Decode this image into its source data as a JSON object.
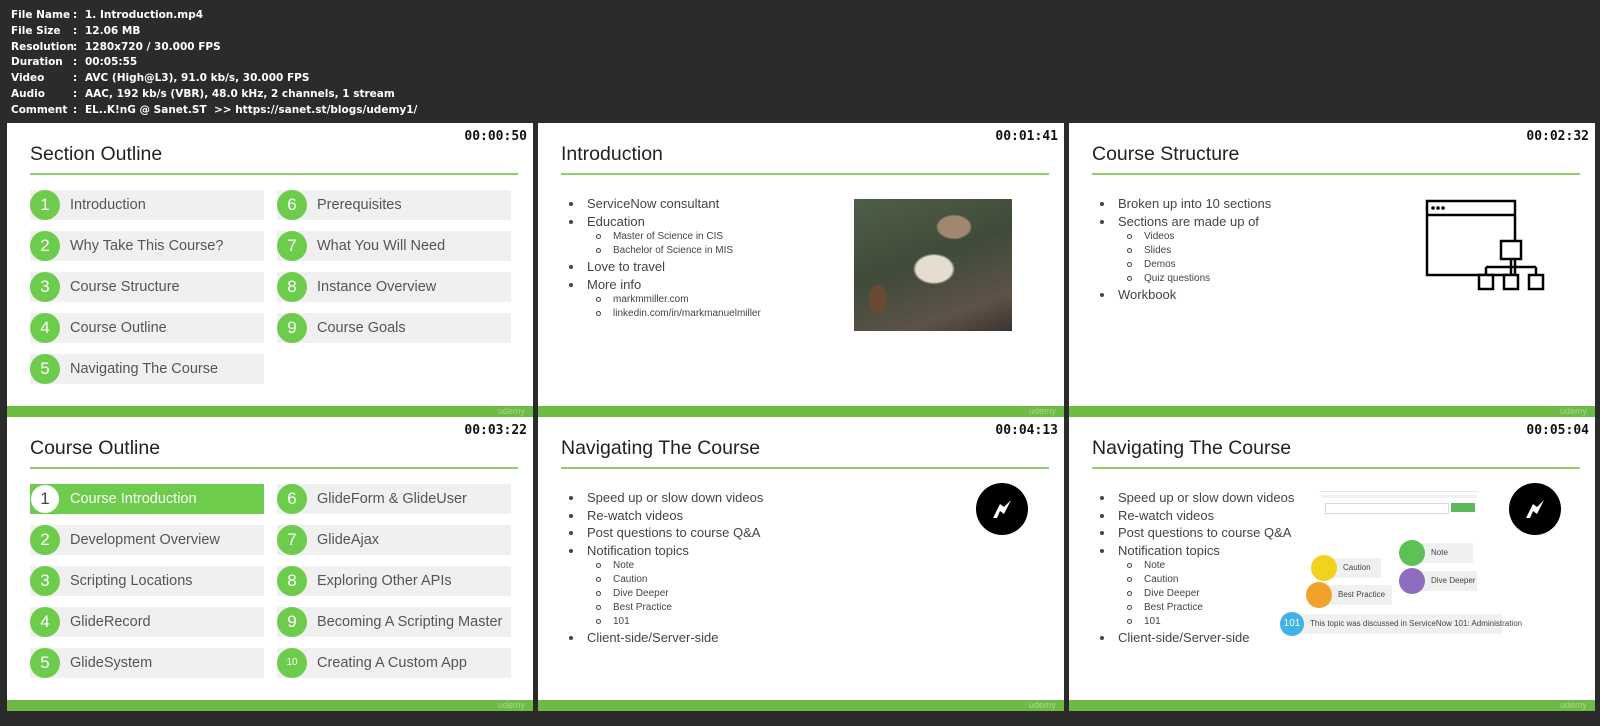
{
  "file_info": {
    "rows": [
      {
        "key": "File Name",
        "value": "1. Introduction.mp4"
      },
      {
        "key": "File Size",
        "value": "12.06 MB"
      },
      {
        "key": "Resolution",
        "value": "1280x720 / 30.000 FPS"
      },
      {
        "key": "Duration",
        "value": "00:05:55"
      },
      {
        "key": "Video",
        "value": "AVC (High@L3), 91.0 kb/s, 30.000 FPS"
      },
      {
        "key": "Audio",
        "value": "AAC, 192 kb/s (VBR), 48.0 kHz, 2 channels, 1 stream"
      },
      {
        "key": "Comment",
        "value": "EL..K!nG @ Sanet.ST  >> https://sanet.st/blogs/udemy1/"
      }
    ]
  },
  "brand": "udemy",
  "colors": {
    "accent": "#6dcc4b",
    "footer": "#6dbb45",
    "rule": "#8fcf6a"
  },
  "slides": [
    {
      "timestamp": "00:00:50",
      "title": "Section Outline",
      "items": [
        {
          "num": "1",
          "label": "Introduction"
        },
        {
          "num": "2",
          "label": "Why Take This Course?"
        },
        {
          "num": "3",
          "label": "Course Structure"
        },
        {
          "num": "4",
          "label": "Course Outline"
        },
        {
          "num": "5",
          "label": "Navigating The Course"
        },
        {
          "num": "6",
          "label": "Prerequisites"
        },
        {
          "num": "7",
          "label": "What You Will Need"
        },
        {
          "num": "8",
          "label": "Instance Overview"
        },
        {
          "num": "9",
          "label": "Course Goals"
        }
      ]
    },
    {
      "timestamp": "00:01:41",
      "title": "Introduction",
      "bullets": [
        "ServiceNow consultant",
        "Education",
        "Master of Science in CIS",
        "Bachelor of Science in MIS",
        "Love to travel",
        "More info",
        "markmmiller.com",
        "linkedin.com/in/markmanuelmiller"
      ]
    },
    {
      "timestamp": "00:02:32",
      "title": "Course Structure",
      "bullets": [
        "Broken up into 10 sections",
        "Sections are made up of",
        "Videos",
        "Slides",
        "Demos",
        "Quiz questions",
        "Workbook"
      ],
      "icon": "sitemap-window-icon"
    },
    {
      "timestamp": "00:03:22",
      "title": "Course Outline",
      "items": [
        {
          "num": "1",
          "label": "Course Introduction"
        },
        {
          "num": "2",
          "label": "Development Overview"
        },
        {
          "num": "3",
          "label": "Scripting Locations"
        },
        {
          "num": "4",
          "label": "GlideRecord"
        },
        {
          "num": "5",
          "label": "GlideSystem"
        },
        {
          "num": "6",
          "label": "GlideForm & GlideUser"
        },
        {
          "num": "7",
          "label": "GlideAjax"
        },
        {
          "num": "8",
          "label": "Exploring Other APIs"
        },
        {
          "num": "9",
          "label": "Becoming A Scripting Master"
        },
        {
          "num": "10",
          "label": "Creating A Custom App"
        }
      ]
    },
    {
      "timestamp": "00:04:13",
      "title": "Navigating The Course",
      "bullets": [
        "Speed up or slow down videos",
        "Re-watch videos",
        "Post questions to course Q&A",
        "Notification topics",
        "Note",
        "Caution",
        "Dive Deeper",
        "Best Practice",
        "101",
        "Client-side/Server-side"
      ]
    },
    {
      "timestamp": "00:05:04",
      "title": "Navigating The Course",
      "bullets": [
        "Speed up or slow down videos",
        "Re-watch videos",
        "Post questions to course Q&A",
        "Notification topics",
        "Note",
        "Caution",
        "Dive Deeper",
        "Best Practice",
        "101",
        "Client-side/Server-side"
      ],
      "chips": {
        "note": "Note",
        "caution": "Caution",
        "dive_deeper": "Dive Deeper",
        "best_practice": "Best Practice",
        "num_101": "101",
        "discussed": "This topic was discussed in ServiceNow 101: Administration"
      }
    }
  ]
}
